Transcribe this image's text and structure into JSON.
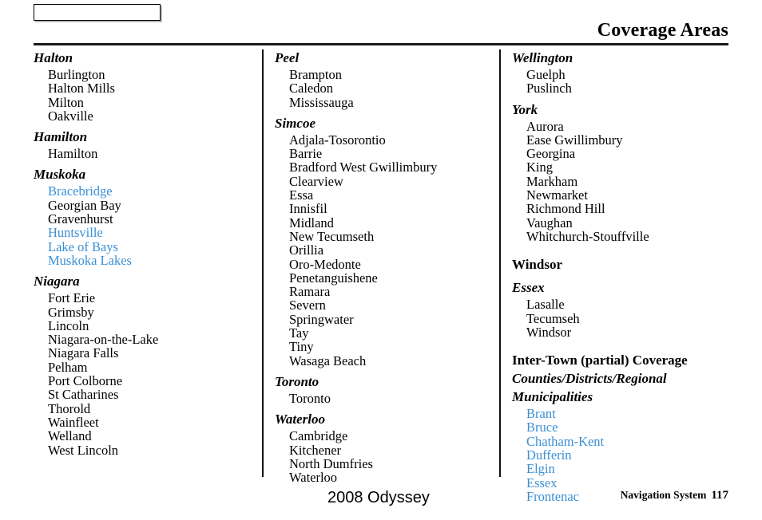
{
  "header": {
    "tab_label": "",
    "title": "Coverage Areas"
  },
  "colors": {
    "link": "#3b8fd4",
    "rule": "#1a1a1a",
    "text": "#000000"
  },
  "columns": [
    {
      "name": "column-1",
      "groups": [
        {
          "heading": "Halton",
          "style": "italic",
          "items": [
            {
              "label": "Burlington",
              "link": false
            },
            {
              "label": "Halton Mills",
              "link": false
            },
            {
              "label": "Milton",
              "link": false
            },
            {
              "label": "Oakville",
              "link": false
            }
          ]
        },
        {
          "heading": "Hamilton",
          "style": "italic",
          "items": [
            {
              "label": "Hamilton",
              "link": false
            }
          ]
        },
        {
          "heading": "Muskoka",
          "style": "italic",
          "items": [
            {
              "label": "Bracebridge",
              "link": true
            },
            {
              "label": "Georgian Bay",
              "link": false
            },
            {
              "label": "Gravenhurst",
              "link": false
            },
            {
              "label": "Huntsville",
              "link": true
            },
            {
              "label": "Lake of Bays",
              "link": true
            },
            {
              "label": "Muskoka Lakes",
              "link": true
            }
          ]
        },
        {
          "heading": "Niagara",
          "style": "italic",
          "items": [
            {
              "label": "Fort Erie",
              "link": false
            },
            {
              "label": "Grimsby",
              "link": false
            },
            {
              "label": "Lincoln",
              "link": false
            },
            {
              "label": "Niagara-on-the-Lake",
              "link": false
            },
            {
              "label": "Niagara Falls",
              "link": false
            },
            {
              "label": "Pelham",
              "link": false
            },
            {
              "label": "Port Colborne",
              "link": false
            },
            {
              "label": "St Catharines",
              "link": false
            },
            {
              "label": "Thorold",
              "link": false
            },
            {
              "label": "Wainfleet",
              "link": false
            },
            {
              "label": "Welland",
              "link": false
            },
            {
              "label": "West Lincoln",
              "link": false
            }
          ]
        }
      ]
    },
    {
      "name": "column-2",
      "groups": [
        {
          "heading": "Peel",
          "style": "italic",
          "items": [
            {
              "label": "Brampton",
              "link": false
            },
            {
              "label": "Caledon",
              "link": false
            },
            {
              "label": "Mississauga",
              "link": false
            }
          ]
        },
        {
          "heading": "Simcoe",
          "style": "italic",
          "items": [
            {
              "label": "Adjala-Tosorontio",
              "link": false
            },
            {
              "label": "Barrie",
              "link": false
            },
            {
              "label": "Bradford West Gwillimbury",
              "link": false
            },
            {
              "label": "Clearview",
              "link": false
            },
            {
              "label": "Essa",
              "link": false
            },
            {
              "label": "Innisfil",
              "link": false
            },
            {
              "label": "Midland",
              "link": false
            },
            {
              "label": "New Tecumseth",
              "link": false
            },
            {
              "label": "Orillia",
              "link": false
            },
            {
              "label": "Oro-Medonte",
              "link": false
            },
            {
              "label": "Penetanguishene",
              "link": false
            },
            {
              "label": "Ramara",
              "link": false
            },
            {
              "label": "Severn",
              "link": false
            },
            {
              "label": "Springwater",
              "link": false
            },
            {
              "label": "Tay",
              "link": false
            },
            {
              "label": "Tiny",
              "link": false
            },
            {
              "label": "Wasaga Beach",
              "link": false
            }
          ]
        },
        {
          "heading": "Toronto",
          "style": "italic",
          "items": [
            {
              "label": "Toronto",
              "link": false
            }
          ]
        },
        {
          "heading": "Waterloo",
          "style": "italic",
          "items": [
            {
              "label": "Cambridge",
              "link": false
            },
            {
              "label": "Kitchener",
              "link": false
            },
            {
              "label": "North Dumfries",
              "link": false
            },
            {
              "label": "Waterloo",
              "link": false
            }
          ]
        }
      ]
    },
    {
      "name": "column-3",
      "groups": [
        {
          "heading": "Wellington",
          "style": "italic",
          "items": [
            {
              "label": "Guelph",
              "link": false
            },
            {
              "label": "Puslinch",
              "link": false
            }
          ]
        },
        {
          "heading": "York",
          "style": "italic",
          "items": [
            {
              "label": "Aurora",
              "link": false
            },
            {
              "label": "Ease Gwillimbury",
              "link": false
            },
            {
              "label": "Georgina",
              "link": false
            },
            {
              "label": "King",
              "link": false
            },
            {
              "label": "Markham",
              "link": false
            },
            {
              "label": "Newmarket",
              "link": false
            },
            {
              "label": "Richmond Hill",
              "link": false
            },
            {
              "label": "Vaughan",
              "link": false
            },
            {
              "label": "Whitchurch-Stouffville",
              "link": false
            }
          ]
        },
        {
          "heading": "Windsor",
          "style": "upright-block",
          "items": []
        },
        {
          "heading": "Essex",
          "style": "italic",
          "items": [
            {
              "label": "Lasalle",
              "link": false
            },
            {
              "label": "Tecumseh",
              "link": false
            },
            {
              "label": "Windsor",
              "link": false
            }
          ]
        },
        {
          "heading": "Inter-Town (partial) Coverage",
          "style": "upright-block",
          "subheading_lines": [
            "Counties/Districts/Regional",
            "Municipalities"
          ],
          "items": [
            {
              "label": "Brant",
              "link": true
            },
            {
              "label": "Bruce",
              "link": true
            },
            {
              "label": "Chatham-Kent",
              "link": true
            },
            {
              "label": "Dufferin",
              "link": true
            },
            {
              "label": "Elgin",
              "link": true
            },
            {
              "label": "Essex",
              "link": true
            },
            {
              "label": "Frontenac",
              "link": true
            }
          ]
        }
      ]
    }
  ],
  "footer": {
    "model_year": "2008  Odyssey",
    "manual_section": "Navigation System",
    "page_number": "117"
  }
}
